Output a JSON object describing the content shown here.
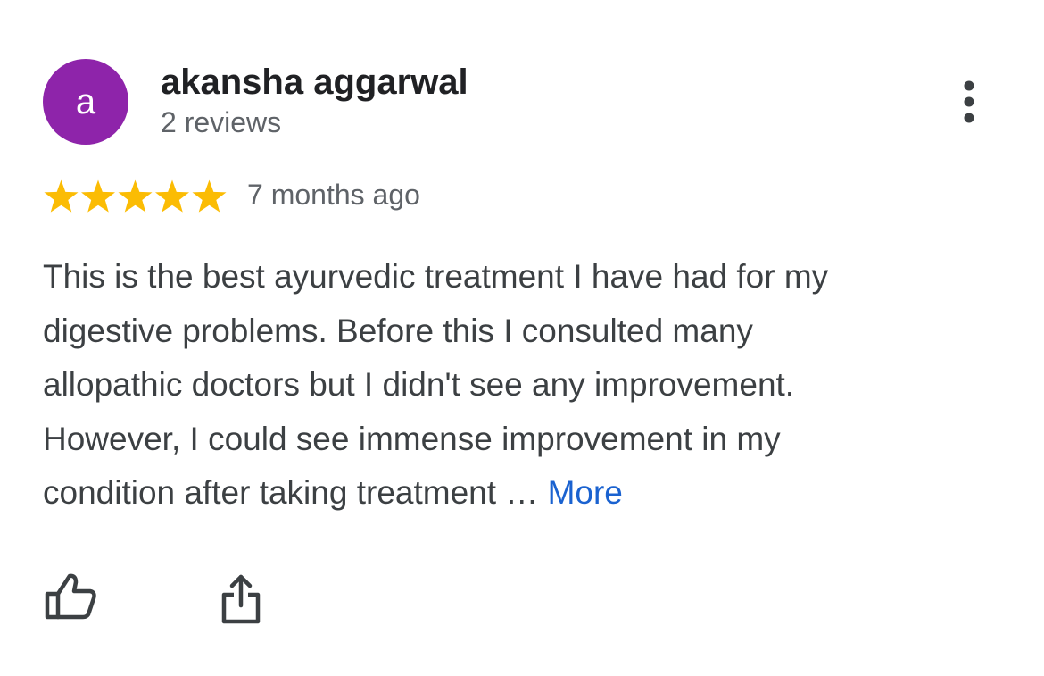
{
  "reviewer": {
    "avatar_letter": "a",
    "avatar_color": "#8e24aa",
    "name": "akansha aggarwal",
    "review_count": "2 reviews"
  },
  "rating": {
    "stars": 5,
    "max_stars": 5,
    "star_color": "#fbbc04",
    "time_ago": "7 months ago"
  },
  "review": {
    "lines": [
      "This is the best ayurvedic treatment I have had for my",
      "digestive problems. Before this I consulted many",
      "allopathic doctors but I didn't see any improvement.",
      "However, I could see immense improvement in my",
      "condition after taking treatment … "
    ],
    "more_label": "More",
    "link_color": "#1a62d0"
  },
  "actions": {
    "like_icon": "thumbs-up-icon",
    "share_icon": "share-icon",
    "menu_icon": "more-vertical-icon"
  }
}
